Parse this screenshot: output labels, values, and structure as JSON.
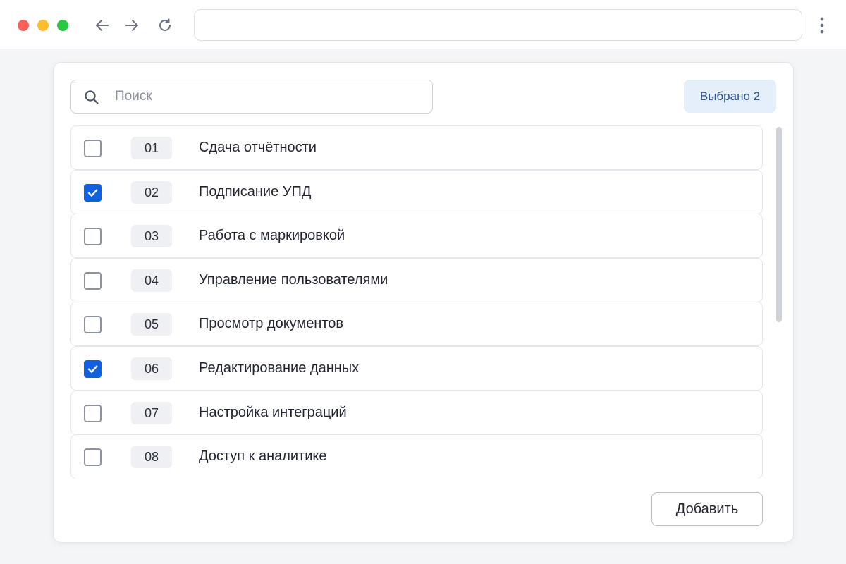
{
  "browser": {
    "address_value": ""
  },
  "search": {
    "placeholder": "Поиск",
    "value": ""
  },
  "selection": {
    "label": "Выбрано 2"
  },
  "list": {
    "items": [
      {
        "number": "01",
        "label": "Сдача отчётности",
        "checked": false
      },
      {
        "number": "02",
        "label": "Подписание УПД",
        "checked": true
      },
      {
        "number": "03",
        "label": "Работа с маркировкой",
        "checked": false
      },
      {
        "number": "04",
        "label": "Управление пользователями",
        "checked": false
      },
      {
        "number": "05",
        "label": "Просмотр документов",
        "checked": false
      },
      {
        "number": "06",
        "label": "Редактирование данных",
        "checked": true
      },
      {
        "number": "07",
        "label": "Настройка интеграций",
        "checked": false
      },
      {
        "number": "08",
        "label": "Доступ к аналитике",
        "checked": false
      }
    ]
  },
  "actions": {
    "add_label": "Добавить"
  },
  "colors": {
    "accent": "#1160e0",
    "badge_background": "#e5eefb",
    "badge_text": "#2a4f8f"
  },
  "icons": {
    "back": "arrow-left-icon",
    "forward": "arrow-right-icon",
    "reload": "reload-icon",
    "menu": "vertical-dots-icon",
    "search": "search-icon",
    "check": "checkmark-icon"
  }
}
